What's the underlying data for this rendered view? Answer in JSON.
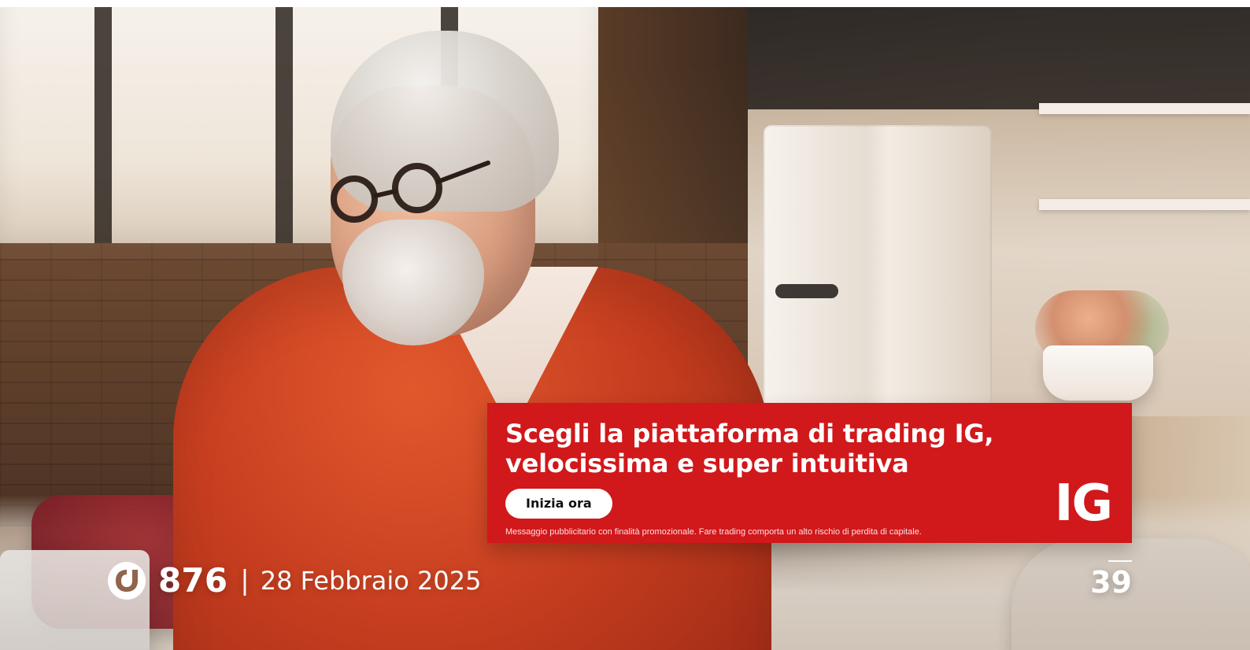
{
  "ad": {
    "headline": "Scegli la piattaforma di trading IG, velocissima e super intuitiva",
    "cta_label": "Inizia ora",
    "disclaimer": "Messaggio pubblicitario con finalità promozionale. Fare trading comporta un alto rischio di perdita di capitale.",
    "brand": "IG",
    "colors": {
      "banner_red": "#d1181b",
      "text_white": "#ffffff",
      "button_bg": "#ffffff",
      "button_text": "#111111"
    }
  },
  "footer": {
    "issue_number": "876",
    "separator": "|",
    "date": "28 Febbraio 2025",
    "page_number": "39"
  },
  "icons": {
    "publication_logo": "publication-logo-icon"
  }
}
